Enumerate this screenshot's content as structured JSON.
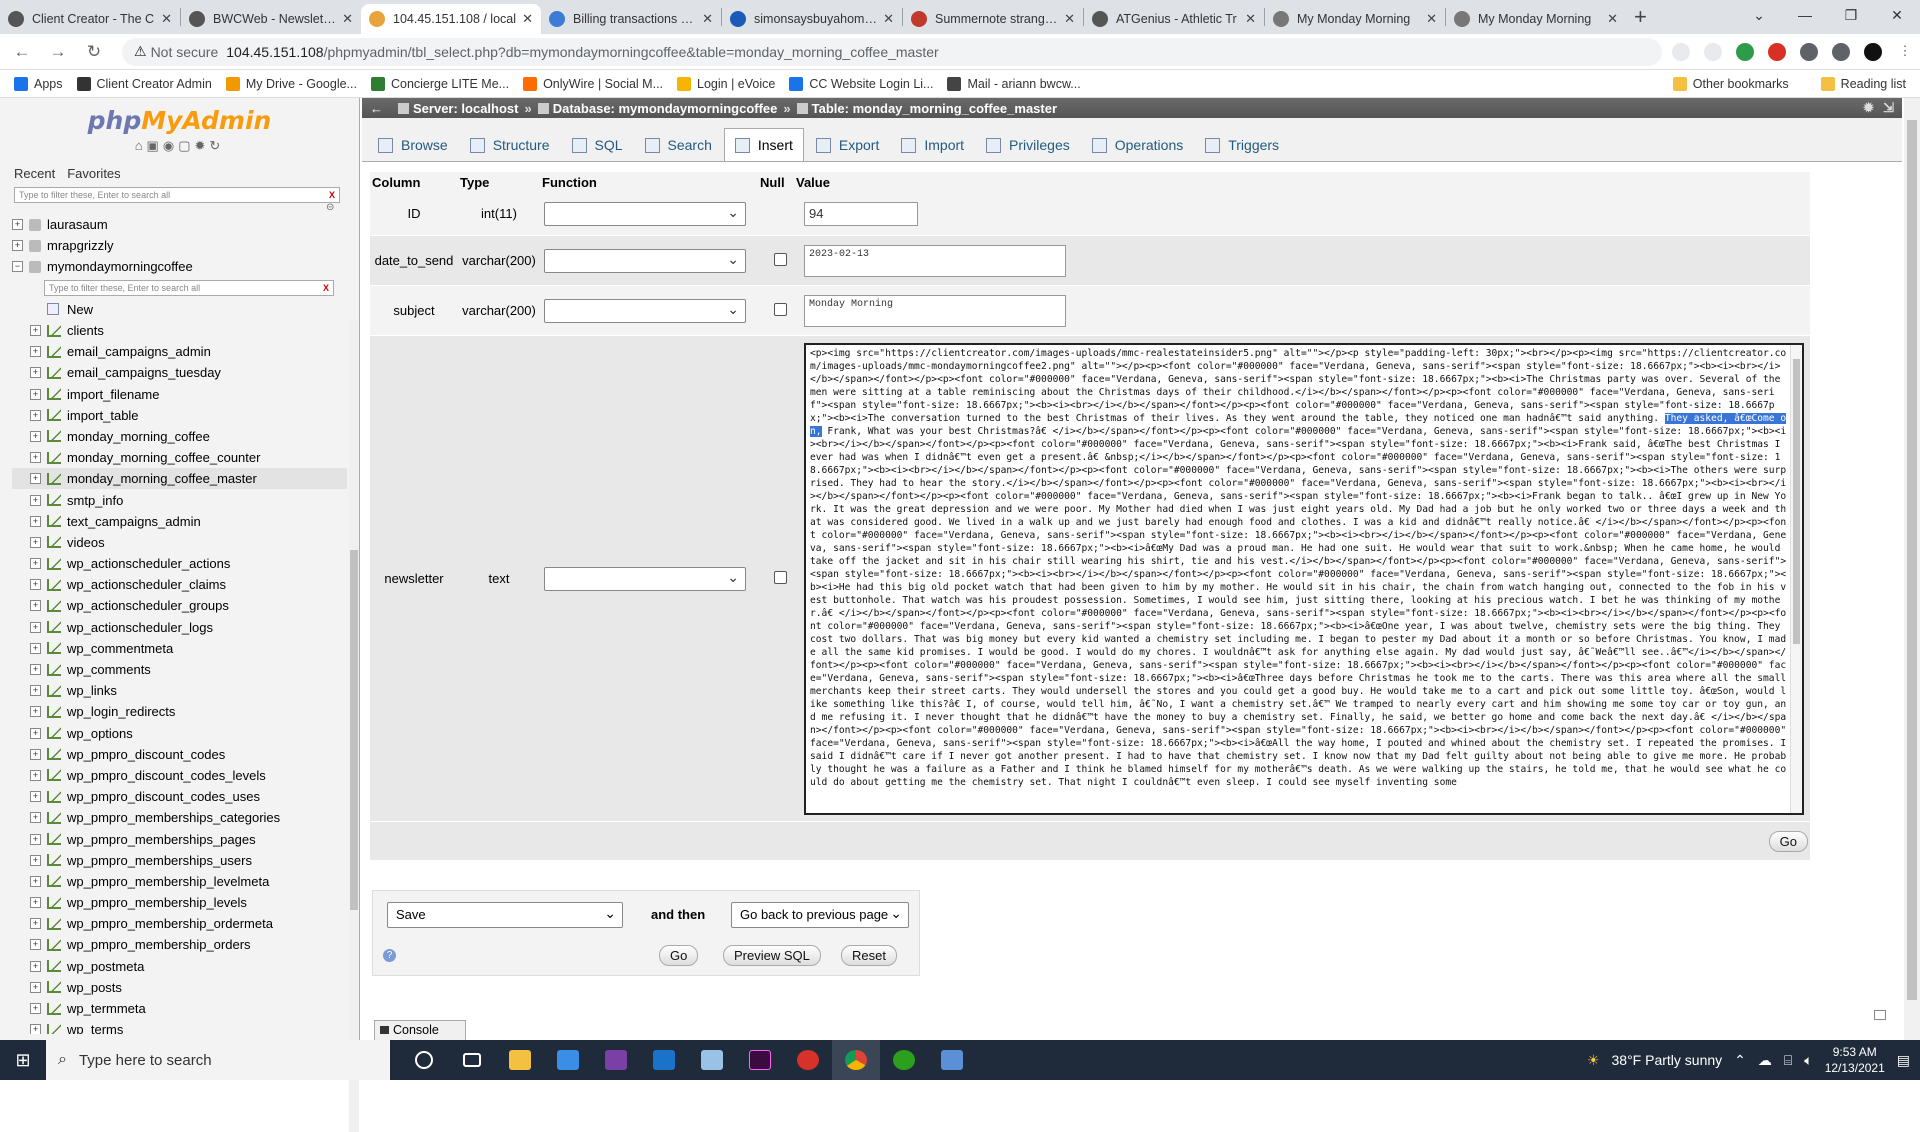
{
  "browser": {
    "tabs": [
      {
        "title": "Client Creator - The C",
        "active": false
      },
      {
        "title": "BWCWeb - Newsletter",
        "active": false
      },
      {
        "title": "104.45.151.108 / local",
        "active": true
      },
      {
        "title": "Billing transactions - B",
        "active": false
      },
      {
        "title": "simonsaysbuyahome.c",
        "active": false
      },
      {
        "title": "Summernote strange c",
        "active": false
      },
      {
        "title": "ATGenius - Athletic Tr",
        "active": false
      },
      {
        "title": "My Monday Morning",
        "active": false
      },
      {
        "title": "My Monday Morning",
        "active": false
      }
    ],
    "security": "Not secure",
    "url_host": "104.45.151.108",
    "url_path": "/phpmyadmin/tbl_select.php?db=mymondaymorningcoffee&table=monday_morning_coffee_master",
    "bookmarks": [
      "Apps",
      "Client Creator Admin",
      "My Drive - Google...",
      "Concierge LITE Me...",
      "OnlyWire | Social M...",
      "Login | eVoice",
      "CC Website Login Li...",
      "Mail - ariann bwcw..."
    ],
    "bookmarks_right": [
      "Other bookmarks",
      "Reading list"
    ]
  },
  "sidebar": {
    "logo_php": "php",
    "logo_myadmin": "MyAdmin",
    "tab_recent": "Recent",
    "tab_favorites": "Favorites",
    "filter_placeholder": "Type to filter these, Enter to search all",
    "db_filter_placeholder": "Type to filter these, Enter to search all",
    "items": [
      {
        "label": "laurasaum",
        "indent": 0,
        "type": "db"
      },
      {
        "label": "mrapgrizzly",
        "indent": 0,
        "type": "db"
      },
      {
        "label": "mymondaymorningcoffee",
        "indent": 0,
        "type": "db-open"
      },
      {
        "label": "__filter__",
        "indent": 1,
        "type": "filter"
      },
      {
        "label": "New",
        "indent": 1,
        "type": "new"
      },
      {
        "label": "clients",
        "indent": 1,
        "type": "table"
      },
      {
        "label": "email_campaigns_admin",
        "indent": 1,
        "type": "table"
      },
      {
        "label": "email_campaigns_tuesday",
        "indent": 1,
        "type": "table"
      },
      {
        "label": "import_filename",
        "indent": 1,
        "type": "table"
      },
      {
        "label": "import_table",
        "indent": 1,
        "type": "table"
      },
      {
        "label": "monday_morning_coffee",
        "indent": 1,
        "type": "table"
      },
      {
        "label": "monday_morning_coffee_counter",
        "indent": 1,
        "type": "table"
      },
      {
        "label": "monday_morning_coffee_master",
        "indent": 1,
        "type": "table",
        "selected": true
      },
      {
        "label": "smtp_info",
        "indent": 1,
        "type": "table"
      },
      {
        "label": "text_campaigns_admin",
        "indent": 1,
        "type": "table"
      },
      {
        "label": "videos",
        "indent": 1,
        "type": "table"
      },
      {
        "label": "wp_actionscheduler_actions",
        "indent": 1,
        "type": "table"
      },
      {
        "label": "wp_actionscheduler_claims",
        "indent": 1,
        "type": "table"
      },
      {
        "label": "wp_actionscheduler_groups",
        "indent": 1,
        "type": "table"
      },
      {
        "label": "wp_actionscheduler_logs",
        "indent": 1,
        "type": "table"
      },
      {
        "label": "wp_commentmeta",
        "indent": 1,
        "type": "table"
      },
      {
        "label": "wp_comments",
        "indent": 1,
        "type": "table"
      },
      {
        "label": "wp_links",
        "indent": 1,
        "type": "table"
      },
      {
        "label": "wp_login_redirects",
        "indent": 1,
        "type": "table"
      },
      {
        "label": "wp_options",
        "indent": 1,
        "type": "table"
      },
      {
        "label": "wp_pmpro_discount_codes",
        "indent": 1,
        "type": "table"
      },
      {
        "label": "wp_pmpro_discount_codes_levels",
        "indent": 1,
        "type": "table"
      },
      {
        "label": "wp_pmpro_discount_codes_uses",
        "indent": 1,
        "type": "table"
      },
      {
        "label": "wp_pmpro_memberships_categories",
        "indent": 1,
        "type": "table"
      },
      {
        "label": "wp_pmpro_memberships_pages",
        "indent": 1,
        "type": "table"
      },
      {
        "label": "wp_pmpro_memberships_users",
        "indent": 1,
        "type": "table"
      },
      {
        "label": "wp_pmpro_membership_levelmeta",
        "indent": 1,
        "type": "table"
      },
      {
        "label": "wp_pmpro_membership_levels",
        "indent": 1,
        "type": "table"
      },
      {
        "label": "wp_pmpro_membership_ordermeta",
        "indent": 1,
        "type": "table"
      },
      {
        "label": "wp_pmpro_membership_orders",
        "indent": 1,
        "type": "table"
      },
      {
        "label": "wp_postmeta",
        "indent": 1,
        "type": "table"
      },
      {
        "label": "wp_posts",
        "indent": 1,
        "type": "table"
      },
      {
        "label": "wp_termmeta",
        "indent": 1,
        "type": "table"
      },
      {
        "label": "wp_terms",
        "indent": 1,
        "type": "table"
      }
    ]
  },
  "breadcrumb": {
    "server": "Server: localhost",
    "database": "Database: mymondaymorningcoffee",
    "table": "Table: monday_morning_coffee_master"
  },
  "menu": {
    "tabs": [
      {
        "label": "Browse",
        "active": false
      },
      {
        "label": "Structure",
        "active": false
      },
      {
        "label": "SQL",
        "active": false
      },
      {
        "label": "Search",
        "active": false
      },
      {
        "label": "Insert",
        "active": true
      },
      {
        "label": "Export",
        "active": false
      },
      {
        "label": "Import",
        "active": false
      },
      {
        "label": "Privileges",
        "active": false
      },
      {
        "label": "Operations",
        "active": false
      },
      {
        "label": "Triggers",
        "active": false
      }
    ]
  },
  "insert_form": {
    "headers": {
      "column": "Column",
      "type": "Type",
      "function": "Function",
      "null": "Null",
      "value": "Value"
    },
    "rows": [
      {
        "column": "ID",
        "type": "int(11)",
        "value": "94",
        "has_null": false
      },
      {
        "column": "date_to_send",
        "type": "varchar(200)",
        "value": "2023-02-13",
        "has_null": true
      },
      {
        "column": "subject",
        "type": "varchar(200)",
        "value": "Monday Morning",
        "has_null": true
      },
      {
        "column": "newsletter",
        "type": "text",
        "has_null": true
      }
    ],
    "newsletter_before_hl": "<p><img src=\"https://clientcreator.com/images-uploads/mmc-realestateinsider5.png\" alt=\"\"></p><p style=\"padding-left: 30px;\"><br></p><p><img src=\"https://clientcreator.com/images-uploads/mmc-mondaymorningcoffee2.png\" alt=\"\"></p><p><font color=\"#000000\" face=\"Verdana, Geneva, sans-serif\"><span style=\"font-size: 18.6667px;\"><b><i><br></i></b></span></font></p><p><font color=\"#000000\" face=\"Verdana, Geneva, sans-serif\"><span style=\"font-size: 18.6667px;\"><b><i>The Christmas party was over. Several of the men were sitting at a table reminiscing about the Christmas days of their childhood.</i></b></span></font></p><p><font color=\"#000000\" face=\"Verdana, Geneva, sans-serif\"><span style=\"font-size: 18.6667px;\"><b><i><br></i></b></span></font></p><p><font color=\"#000000\" face=\"Verdana, Geneva, sans-serif\"><span style=\"font-size: 18.6667px;\"><b><i>The conversation turned to the best Christmas of their lives. As they went around the table, they noticed one man hadnâ€™t said anything. ",
    "newsletter_hl": "They asked, â€œCome on,",
    "newsletter_after_hl": " Frank, What was your best Christmas?â€</i></b></span></font></p><p><font color=\"#000000\" face=\"Verdana, Geneva, sans-serif\"><span style=\"font-size: 18.6667px;\"><b><i><br></i></b></span></font></p><p><font color=\"#000000\" face=\"Verdana, Geneva, sans-serif\"><span style=\"font-size: 18.6667px;\"><b><i>Frank said, â€œThe best Christmas I ever had was when I didnâ€™t even get a present.â€&nbsp;</i></b></span></font></p><p><font color=\"#000000\" face=\"Verdana, Geneva, sans-serif\"><span style=\"font-size: 18.6667px;\"><b><i><br></i></b></span></font></p><p><font color=\"#000000\" face=\"Verdana, Geneva, sans-serif\"><span style=\"font-size: 18.6667px;\"><b><i>The others were surprised. They had to hear the story.</i></b></span></font></p><p><font color=\"#000000\" face=\"Verdana, Geneva, sans-serif\"><span style=\"font-size: 18.6667px;\"><b><i><br></i></b></span></font></p><p><font color=\"#000000\" face=\"Verdana, Geneva, sans-serif\"><span style=\"font-size: 18.6667px;\"><b><i>Frank began to talk.. â€œI grew up in New York. It was the great depression and we were poor. My Mother had died when I was just eight years old. My Dad had a job but he only worked two or three days a week and that was considered good. We lived in a walk up and we just barely had enough food and clothes. I was a kid and didnâ€™t really notice.â€</i></b></span></font></p><p><font color=\"#000000\" face=\"Verdana, Geneva, sans-serif\"><span style=\"font-size: 18.6667px;\"><b><i><br></i></b></span></font></p><p><font color=\"#000000\" face=\"Verdana, Geneva, sans-serif\"><span style=\"font-size: 18.6667px;\"><b><i>â€œMy Dad was a proud man. He had one suit. He would wear that suit to work.&nbsp; When he came home, he would take off the jacket and sit in his chair still wearing his shirt, tie and his vest.</i></b></span></font></p><p><font color=\"#000000\" face=\"Verdana, Geneva, sans-serif\"><span style=\"font-size: 18.6667px;\"><b><i><br></i></b></span></font></p><p><font color=\"#000000\" face=\"Verdana, Geneva, sans-serif\"><span style=\"font-size: 18.6667px;\"><b><i>He had this big old pocket watch that had been given to him by my mother. He would sit in his chair, the chain from watch hanging out, connected to the fob in his vest buttonhole. That watch was his proudest possession. Sometimes, I would see him, just sitting there, looking at his precious watch. I bet he was thinking of my mother.â€</i></b></span></font></p><p><font color=\"#000000\" face=\"Verdana, Geneva, sans-serif\"><span style=\"font-size: 18.6667px;\"><b><i><br></i></b></span></font></p><p><font color=\"#000000\" face=\"Verdana, Geneva, sans-serif\"><span style=\"font-size: 18.6667px;\"><b><i>â€œOne year, I was about twelve, chemistry sets were the big thing. They cost two dollars. That was big money but every kid wanted a chemistry set including me. I began to pester my Dad about it a month or so before Christmas. You know, I made all the same kid promises. I would be good. I would do my chores. I wouldnâ€™t ask for anything else again. My dad would just say, â€˜Weâ€™ll see..â€™</i></b></span></font></p><p><font color=\"#000000\" face=\"Verdana, Geneva, sans-serif\"><span style=\"font-size: 18.6667px;\"><b><i><br></i></b></span></font></p><p><font color=\"#000000\" face=\"Verdana, Geneva, sans-serif\"><span style=\"font-size: 18.6667px;\"><b><i>â€œThree days before Christmas he took me to the carts. There was this area where all the small merchants keep their street carts. They would undersell the stores and you could get a good buy. He would take me to a cart and pick out some little toy. â€œSon, would like something like this?â€ I, of course, would tell him, â€˜No, I want a chemistry set.â€™ We tramped to nearly every cart and him showing me some toy car or toy gun, and me refusing it. I never thought that he didnâ€™t have the money to buy a chemistry set. Finally, he said, we better go home and come back the next day.â€</i></b></span></font></p><p><font color=\"#000000\" face=\"Verdana, Geneva, sans-serif\"><span style=\"font-size: 18.6667px;\"><b><i><br></i></b></span></font></p><p><font color=\"#000000\" face=\"Verdana, Geneva, sans-serif\"><span style=\"font-size: 18.6667px;\"><b><i>â€œAll the way home, I pouted and whined about the chemistry set. I repeated the promises. I said I didnâ€™t care if I never got another present. I had to have that chemistry set. I know now that my Dad felt guilty about not being able to give me more. He probably thought he was a failure as a Father and I think he blamed himself for my motherâ€™s death. As we were walking up the stairs, he told me, that he would see what he could do about getting me the chemistry set. That night I couldnâ€™t even sleep. I could see myself inventing some",
    "go_label": "Go"
  },
  "bottom": {
    "action": "Save",
    "and_then": "and then",
    "after": "Go back to previous page",
    "go": "Go",
    "preview": "Preview SQL",
    "reset": "Reset",
    "console": "Console"
  },
  "taskbar": {
    "search_placeholder": "Type here to search",
    "weather": "38°F  Partly sunny",
    "time": "9:53 AM",
    "date": "12/13/2021"
  }
}
